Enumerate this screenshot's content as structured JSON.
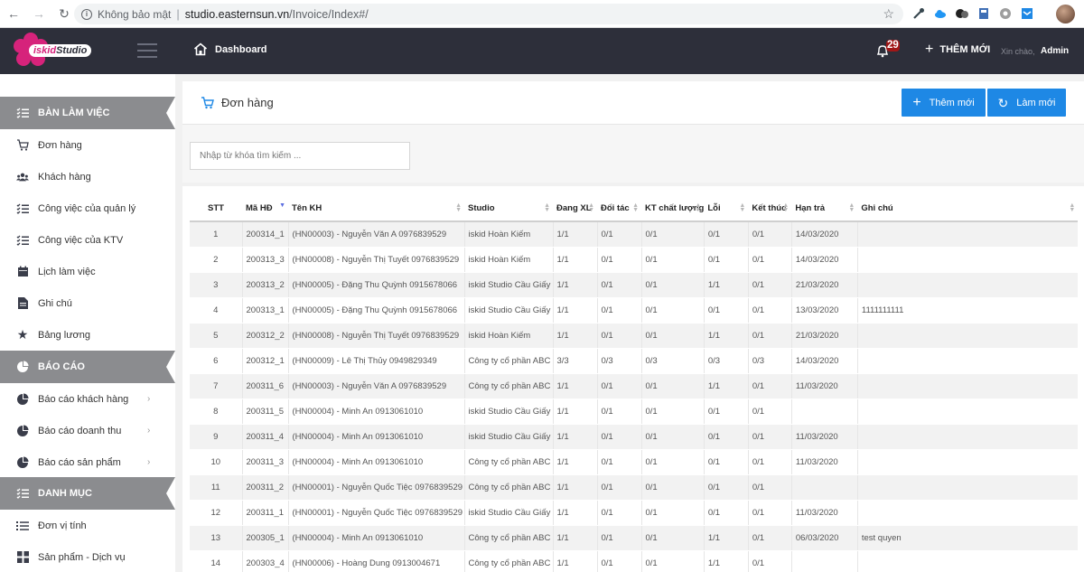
{
  "browser": {
    "insecure_label": "Không bảo mật",
    "url_host": "studio.easternsun.vn",
    "url_path": "/Invoice/Index#/"
  },
  "header": {
    "logo_text": "iskid Studio",
    "dashboard_label": "Dashboard",
    "notification_count": "29",
    "add_new_label": "THÊM MỚI",
    "greeting": "Xin chào,",
    "username": "Admin"
  },
  "sidebar": {
    "sections": [
      {
        "title": "BÀN LÀM VIỆC",
        "items": [
          {
            "label": "Đơn hàng",
            "icon": "cart-icon"
          },
          {
            "label": "Khách hàng",
            "icon": "users-icon"
          },
          {
            "label": "Công việc của quản lý",
            "icon": "tasks-icon"
          },
          {
            "label": "Công việc của KTV",
            "icon": "tasks-icon"
          },
          {
            "label": "Lịch làm việc",
            "icon": "calendar-icon"
          },
          {
            "label": "Ghi chú",
            "icon": "note-icon"
          },
          {
            "label": "Bảng lương",
            "icon": "star-icon"
          }
        ]
      },
      {
        "title": "BÁO CÁO",
        "items": [
          {
            "label": "Báo cáo khách hàng",
            "icon": "pie-chart-icon"
          },
          {
            "label": "Báo cáo doanh thu",
            "icon": "pie-chart-icon"
          },
          {
            "label": "Báo cáo sản phẩm",
            "icon": "pie-chart-icon"
          }
        ]
      },
      {
        "title": "DANH MỤC",
        "items": [
          {
            "label": "Đơn vị tính",
            "icon": "list-icon"
          },
          {
            "label": "Sản phẩm - Dịch vụ",
            "icon": "grid-icon"
          }
        ]
      }
    ]
  },
  "main": {
    "title": "Đơn hàng",
    "add_button": "Thêm mới",
    "refresh_button": "Làm mới",
    "search_placeholder": "Nhập từ khóa tìm kiếm ...",
    "columns": [
      "STT",
      "Mã HĐ",
      "Tên KH",
      "Studio",
      "Đang XL",
      "Đối tác",
      "KT chất lượng",
      "Lỗi",
      "Kết thúc",
      "Hạn trả",
      "Ghi chú"
    ],
    "rows": [
      [
        "1",
        "200314_1",
        "(HN00003) - Nguyễn Văn A 0976839529",
        "iskid Hoàn Kiếm",
        "1/1",
        "0/1",
        "0/1",
        "0/1",
        "0/1",
        "14/03/2020",
        ""
      ],
      [
        "2",
        "200313_3",
        "(HN00008) - Nguyễn Thị Tuyết 0976839529",
        "iskid Hoàn Kiếm",
        "1/1",
        "0/1",
        "0/1",
        "0/1",
        "0/1",
        "14/03/2020",
        ""
      ],
      [
        "3",
        "200313_2",
        "(HN00005) - Đặng Thu Quỳnh 0915678066",
        "iskid Studio Cầu Giấy",
        "1/1",
        "0/1",
        "0/1",
        "1/1",
        "0/1",
        "21/03/2020",
        ""
      ],
      [
        "4",
        "200313_1",
        "(HN00005) - Đặng Thu Quỳnh 0915678066",
        "iskid Studio Cầu Giấy",
        "1/1",
        "0/1",
        "0/1",
        "0/1",
        "0/1",
        "13/03/2020",
        "1111111111"
      ],
      [
        "5",
        "200312_2",
        "(HN00008) - Nguyễn Thị Tuyết 0976839529",
        "iskid Hoàn Kiếm",
        "1/1",
        "0/1",
        "0/1",
        "1/1",
        "0/1",
        "21/03/2020",
        ""
      ],
      [
        "6",
        "200312_1",
        "(HN00009) - Lê Thị Thủy 0949829349",
        "Công ty cổ phần ABC",
        "3/3",
        "0/3",
        "0/3",
        "0/3",
        "0/3",
        "14/03/2020",
        ""
      ],
      [
        "7",
        "200311_6",
        "(HN00003) - Nguyễn Văn A 0976839529",
        "Công ty cổ phần ABC",
        "1/1",
        "0/1",
        "0/1",
        "1/1",
        "0/1",
        "11/03/2020",
        ""
      ],
      [
        "8",
        "200311_5",
        "(HN00004) - Minh An 0913061010",
        "iskid Studio Cầu Giấy",
        "1/1",
        "0/1",
        "0/1",
        "0/1",
        "0/1",
        "",
        ""
      ],
      [
        "9",
        "200311_4",
        "(HN00004) - Minh An 0913061010",
        "iskid Studio Cầu Giấy",
        "1/1",
        "0/1",
        "0/1",
        "0/1",
        "0/1",
        "11/03/2020",
        ""
      ],
      [
        "10",
        "200311_3",
        "(HN00004) - Minh An 0913061010",
        "Công ty cổ phần ABC",
        "1/1",
        "0/1",
        "0/1",
        "0/1",
        "0/1",
        "11/03/2020",
        ""
      ],
      [
        "11",
        "200311_2",
        "(HN00001) - Nguyễn Quốc Tiệc 0976839529",
        "Công ty cổ phần ABC",
        "1/1",
        "0/1",
        "0/1",
        "0/1",
        "0/1",
        "",
        ""
      ],
      [
        "12",
        "200311_1",
        "(HN00001) - Nguyễn Quốc Tiệc 0976839529",
        "iskid Studio Cầu Giấy",
        "1/1",
        "0/1",
        "0/1",
        "0/1",
        "0/1",
        "11/03/2020",
        ""
      ],
      [
        "13",
        "200305_1",
        "(HN00004) - Minh An 0913061010",
        "Công ty cổ phần ABC",
        "1/1",
        "0/1",
        "0/1",
        "1/1",
        "0/1",
        "06/03/2020",
        "test quyen"
      ],
      [
        "14",
        "200303_4",
        "(HN00006) - Hoàng Dung 0913004671",
        "Công ty cổ phần ABC",
        "1/1",
        "0/1",
        "0/1",
        "1/1",
        "0/1",
        "",
        ""
      ]
    ]
  },
  "colors": {
    "header_bg": "#2d2f3a",
    "primary_button": "#1e88e5",
    "section_head": "#8b8c8f",
    "brand_pink": "#d6237b"
  }
}
